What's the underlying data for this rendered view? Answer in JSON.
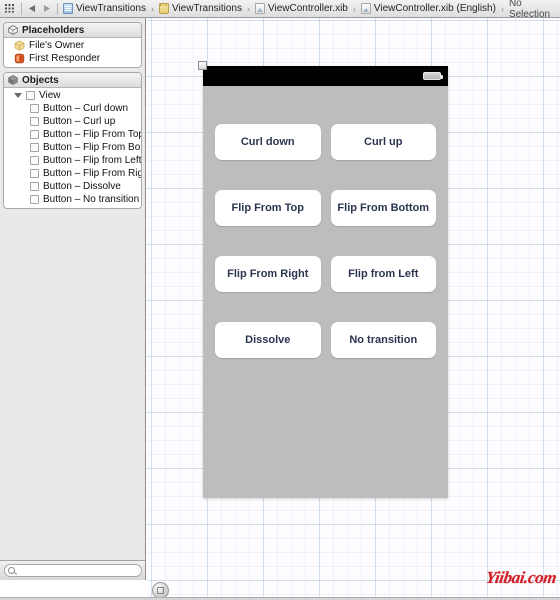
{
  "jumpbar": {
    "grid_icon": "grid-icon",
    "back_icon": "back-arrow-icon",
    "forward_icon": "forward-arrow-icon",
    "breadcrumbs": [
      {
        "icon": "project-icon",
        "label": "ViewTransitions"
      },
      {
        "icon": "folder-icon",
        "label": "ViewTransitions"
      },
      {
        "icon": "xib-file-icon",
        "label": "ViewController.xib"
      },
      {
        "icon": "xib-file-icon",
        "label": "ViewController.xib (English)"
      }
    ],
    "selection": "No Selection",
    "separator": "›"
  },
  "sidebar": {
    "placeholders": {
      "title": "Placeholders",
      "icon": "cube-outline-icon",
      "items": [
        {
          "label": "File's Owner",
          "icon": "files-owner-icon"
        },
        {
          "label": "First Responder",
          "icon": "first-responder-icon"
        }
      ]
    },
    "objects": {
      "title": "Objects",
      "icon": "cube-solid-icon",
      "root": {
        "label": "View",
        "icon": "view-object-icon"
      },
      "items": [
        {
          "label": "Button – Curl down"
        },
        {
          "label": "Button – Curl up"
        },
        {
          "label": "Button – Flip From Top"
        },
        {
          "label": "Button – Flip From Bo…"
        },
        {
          "label": "Button – Flip from Left"
        },
        {
          "label": "Button – Flip From Right"
        },
        {
          "label": "Button – Dissolve"
        },
        {
          "label": "Button – No transition"
        }
      ]
    },
    "filter": {
      "value": "",
      "placeholder": "",
      "icon": "search-icon"
    }
  },
  "canvas": {
    "zoom_button_icon": "zoom-toggle-icon",
    "device": {
      "selection_handle": "resize-handle",
      "statusbar": {
        "battery_icon": "battery-icon"
      },
      "buttons": [
        {
          "label": "Curl down"
        },
        {
          "label": "Curl up"
        },
        {
          "label": "Flip From Top"
        },
        {
          "label": "Flip From Bottom"
        },
        {
          "label": "Flip From Right"
        },
        {
          "label": "Flip from Left"
        },
        {
          "label": "Dissolve"
        },
        {
          "label": "No transition"
        }
      ]
    }
  },
  "watermark": {
    "text": "Yiibai.com"
  },
  "colors": {
    "accent_button_text": "#2c3550",
    "device_background": "#bdbdbd",
    "watermark": "#d21f26",
    "grid_line": "#96b2d2"
  }
}
